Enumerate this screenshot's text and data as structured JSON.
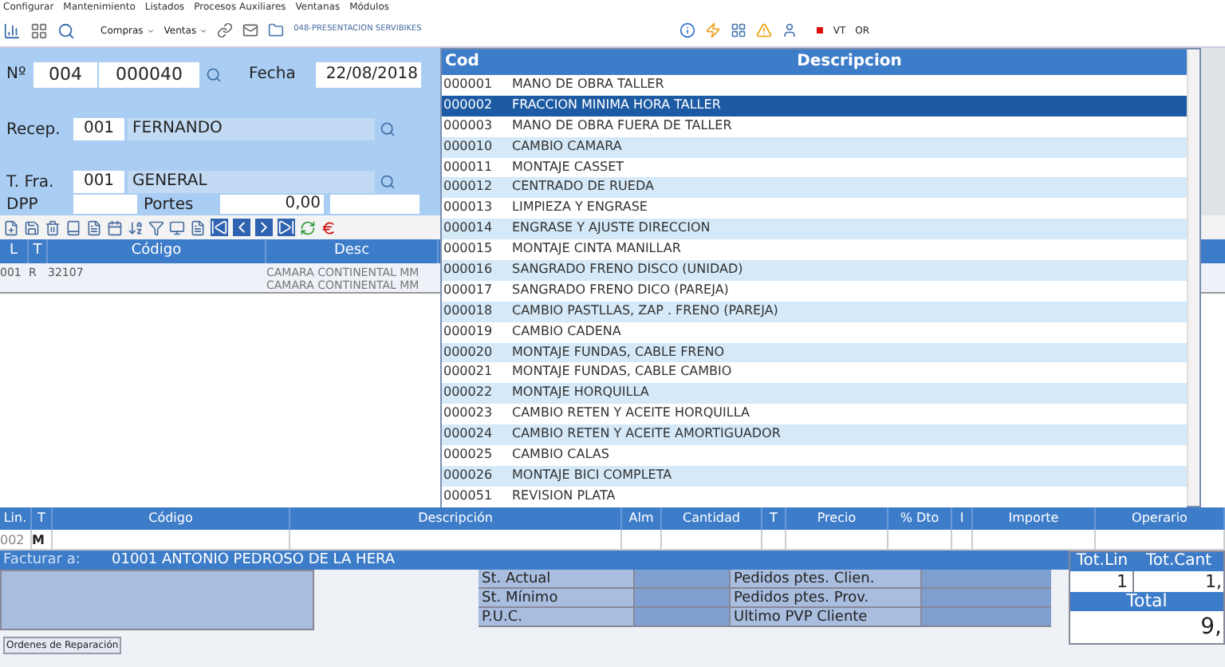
{
  "menu": [
    "Configurar",
    "Mantenimiento",
    "Listados",
    "Procesos Auxiliares",
    "Ventanas",
    "Módulos"
  ],
  "toolbar": {
    "compras": "Compras",
    "ventas": "Ventas",
    "company": "048-PRESENTACION SERVIBIKES",
    "vt": "VT",
    "or": "OR"
  },
  "form": {
    "numero_label": "Nº",
    "serie": "004",
    "numero": "000040",
    "fecha_label": "Fecha",
    "fecha": "22/08/2018",
    "recep_label": "Recep.",
    "recep_code": "001",
    "recep_name": "FERNANDO",
    "tfra_label": "T. Fra.",
    "tfra_code": "001",
    "tfra_name": "GENERAL",
    "dpp_label": "DPP",
    "portes_label": "Portes",
    "portes": "0,00"
  },
  "lines_table": {
    "columns": [
      "L",
      "T",
      "Código",
      "Desc"
    ],
    "rows": [
      {
        "l": "001",
        "t": "R",
        "codigo": "32107",
        "descripcion": [
          "CAMARA CONTINENTAL MM",
          "CAMARA CONTINENTAL MM"
        ]
      }
    ]
  },
  "dropdown": {
    "columns": [
      "Cod",
      "Descripcion"
    ],
    "rows": [
      {
        "cod": "000001",
        "descripcion": "MANO DE OBRA TALLER",
        "selected": false
      },
      {
        "cod": "000002",
        "descripcion": "FRACCION MINIMA HORA TALLER",
        "selected": true
      },
      {
        "cod": "000003",
        "descripcion": "MANO DE OBRA FUERA DE TALLER",
        "selected": false
      },
      {
        "cod": "000010",
        "descripcion": "CAMBIO CAMARA",
        "selected": false
      },
      {
        "cod": "000011",
        "descripcion": "MONTAJE CASSET",
        "selected": false
      },
      {
        "cod": "000012",
        "descripcion": "CENTRADO DE RUEDA",
        "selected": false
      },
      {
        "cod": "000013",
        "descripcion": "LIMPIEZA Y ENGRASE",
        "selected": false
      },
      {
        "cod": "000014",
        "descripcion": "ENGRASE Y AJUSTE DIRECCION",
        "selected": false
      },
      {
        "cod": "000015",
        "descripcion": "MONTAJE CINTA MANILLAR",
        "selected": false
      },
      {
        "cod": "000016",
        "descripcion": "SANGRADO FRENO  DISCO (UNIDAD)",
        "selected": false
      },
      {
        "cod": "000017",
        "descripcion": "SANGRADO FRENO DICO (PAREJA)",
        "selected": false
      },
      {
        "cod": "000018",
        "descripcion": "CAMBIO PASTLLAS, ZAP . FRENO (PAREJA)",
        "selected": false
      },
      {
        "cod": "000019",
        "descripcion": "CAMBIO CADENA",
        "selected": false
      },
      {
        "cod": "000020",
        "descripcion": "MONTAJE FUNDAS, CABLE FRENO",
        "selected": false
      },
      {
        "cod": "000021",
        "descripcion": "MONTAJE FUNDAS, CABLE CAMBIO",
        "selected": false
      },
      {
        "cod": "000022",
        "descripcion": "MONTAJE HORQUILLA",
        "selected": false
      },
      {
        "cod": "000023",
        "descripcion": "CAMBIO RETEN Y ACEITE HORQUILLA",
        "selected": false
      },
      {
        "cod": "000024",
        "descripcion": "CAMBIO RETEN Y ACEITE AMORTIGUADOR",
        "selected": false
      },
      {
        "cod": "000025",
        "descripcion": "CAMBIO CALAS",
        "selected": false
      },
      {
        "cod": "000026",
        "descripcion": "MONTAJE BICI COMPLETA",
        "selected": false
      },
      {
        "cod": "000051",
        "descripcion": "REVISION PLATA",
        "selected": false
      }
    ]
  },
  "entry": {
    "columns": [
      "Lin.",
      "T",
      "Código",
      "Descripción",
      "Alm",
      "Cantidad",
      "T",
      "Precio",
      "% Dto",
      "I",
      "Importe",
      "Operario"
    ],
    "lin": "002",
    "t": "M"
  },
  "facturar": {
    "label": "Facturar a:",
    "value": "01001 ANTONIO PEDROSO DE LA HERA"
  },
  "stock_labels": [
    "St. Actual",
    "St. Mínimo",
    "P.U.C."
  ],
  "pedidos_labels": [
    "Pedidos ptes. Clien.",
    "Pedidos ptes. Prov.",
    "Ultimo PVP Cliente"
  ],
  "totals": {
    "tot_lin_label": "Tot.Lin",
    "tot_cant_label": "Tot.Cant",
    "tot_lin": "1",
    "tot_cant": "1,",
    "total_label": "Total",
    "total": "9,"
  },
  "tab": {
    "label": "Ordenes de Reparación"
  }
}
